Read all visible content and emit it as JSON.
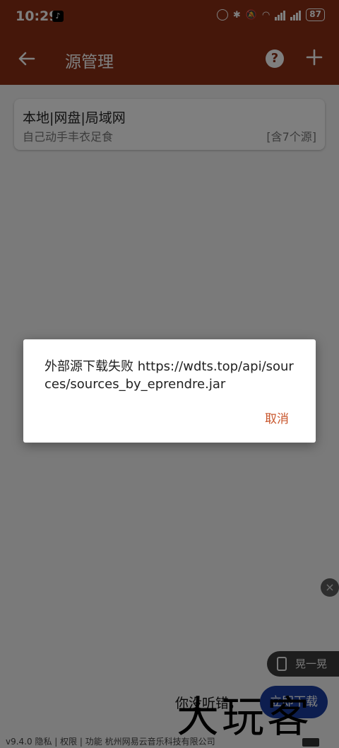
{
  "status_bar": {
    "time": "10:29",
    "battery": "87"
  },
  "app_bar": {
    "title": "源管理",
    "help_glyph": "?"
  },
  "source_list": [
    {
      "title": "本地|网盘|局域网",
      "subtitle": "自己动手丰衣足食",
      "count": "[含7个源]"
    }
  ],
  "dialog": {
    "message": "外部源下载失败 https://wdts.top/api/sources/sources_by_eprendre.jar",
    "cancel_label": "取消"
  },
  "ad": {
    "shake_label": "晃一晃",
    "text": "你没听错，",
    "button_label": "立即下载",
    "close_glyph": "×"
  },
  "watermark": "大玩客",
  "footer": "v9.4.0  隐私 | 权限 | 功能  杭州网易云音乐科技有限公司",
  "colors": {
    "primary": "#8a2e14",
    "accent": "#c8552b"
  }
}
